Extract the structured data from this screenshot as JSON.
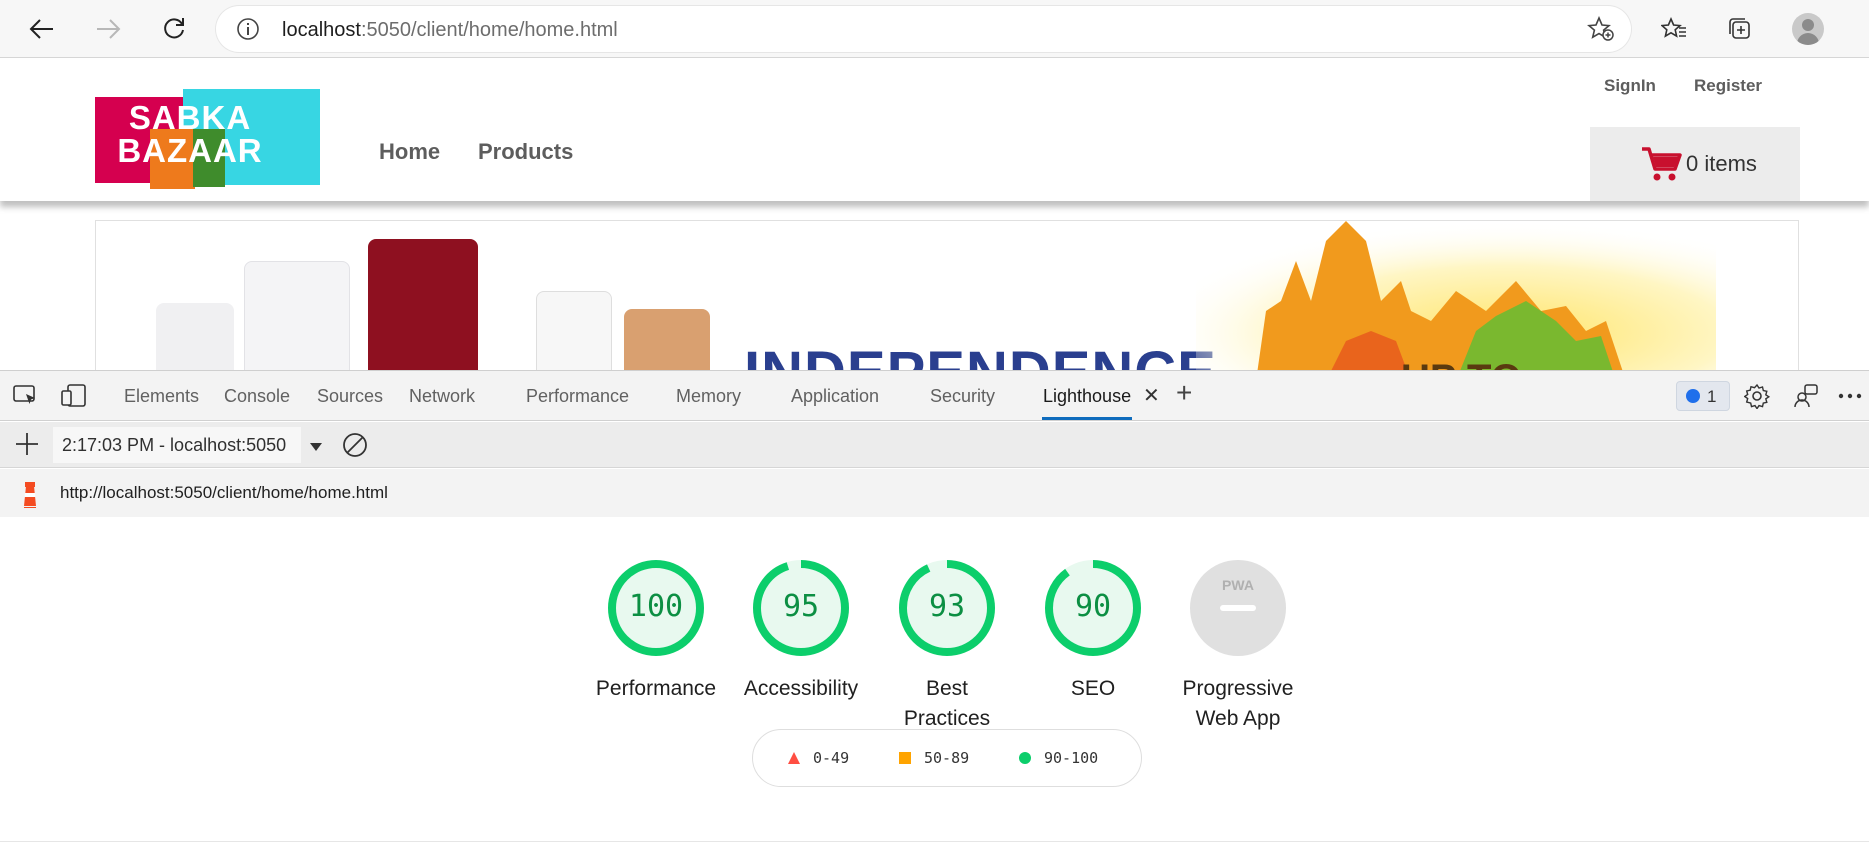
{
  "browser": {
    "url_host": "localhost",
    "url_rest": ":5050/client/home/home.html"
  },
  "site": {
    "logo_line1": "SABKA",
    "logo_line2": "BAZAAR",
    "nav": [
      "Home",
      "Products"
    ],
    "signin": "SignIn",
    "register": "Register",
    "cart_label": "0 items",
    "banner_headline": "INDEPENDENCE",
    "banner_sub": "UP TO"
  },
  "devtools": {
    "tabs": [
      "Elements",
      "Console",
      "Sources",
      "Network",
      "Performance",
      "Memory",
      "Application",
      "Security",
      "Lighthouse"
    ],
    "active_tab": "Lighthouse",
    "issues_count": "1",
    "report_selector": "2:17:03 PM - localhost:5050",
    "report_url": "http://localhost:5050/client/home/home.html"
  },
  "lighthouse": {
    "scores": [
      {
        "label_1": "Performance",
        "label_2": "",
        "value": 100
      },
      {
        "label_1": "Accessibility",
        "label_2": "",
        "value": 95
      },
      {
        "label_1": "Best",
        "label_2": "Practices",
        "value": 93
      },
      {
        "label_1": "SEO",
        "label_2": "",
        "value": 90
      }
    ],
    "pwa": {
      "label_1": "Progressive",
      "label_2": "Web App",
      "badge": "PWA"
    },
    "legend": [
      {
        "range": "0-49",
        "color": "#ff4e42",
        "shape": "triangle"
      },
      {
        "range": "50-89",
        "color": "#ffa400",
        "shape": "square"
      },
      {
        "range": "90-100",
        "color": "#0cce6b",
        "shape": "circle"
      }
    ],
    "colors": {
      "pass": "#0cce6b",
      "pass_text": "#0c8f43",
      "pass_fill": "#e8f9ef",
      "na": "#e0e0e0"
    }
  }
}
